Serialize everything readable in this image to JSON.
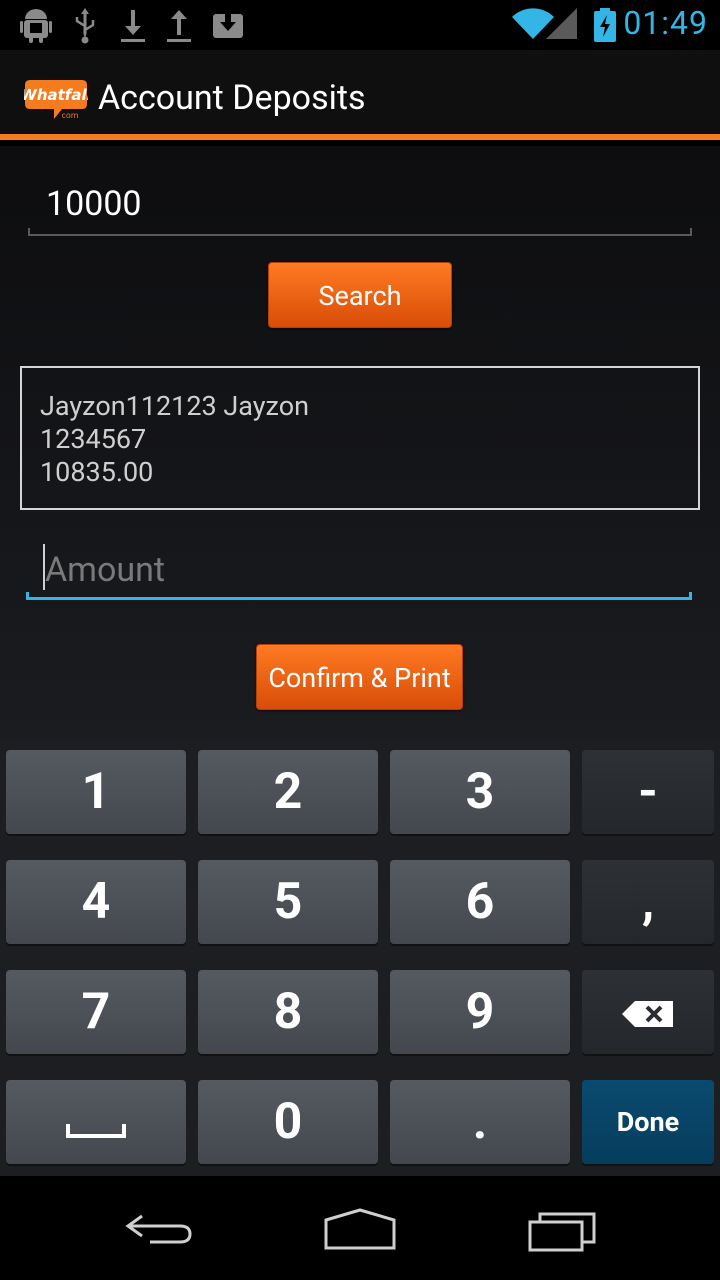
{
  "status_bar": {
    "time": "01:49",
    "icons": [
      "android-icon",
      "usb-icon",
      "download-icon",
      "upload-icon",
      "download-box-icon",
      "wifi-icon",
      "signal-icon",
      "battery-charging-icon"
    ]
  },
  "action_bar": {
    "title": "Account Deposits",
    "logo_text": "Whatfall",
    "logo_subtext": "com",
    "accent_color": "#f57c1e"
  },
  "account_search": {
    "value": "10000",
    "button_label": "Search"
  },
  "account_info": {
    "line1": "Jayzon112123 Jayzon",
    "line2": "1234567",
    "line3": "10835.00"
  },
  "amount": {
    "value": "",
    "placeholder": "Amount"
  },
  "confirm_button_label": "Confirm & Print",
  "keyboard": {
    "keys": [
      [
        "1",
        "2",
        "3",
        "-"
      ],
      [
        "4",
        "5",
        "6",
        ","
      ],
      [
        "7",
        "8",
        "9",
        "backspace-icon"
      ],
      [
        "space-icon",
        "0",
        ".",
        "Done"
      ]
    ]
  },
  "nav_bar": {
    "buttons": [
      "back-icon",
      "home-icon",
      "recent-apps-icon"
    ]
  }
}
